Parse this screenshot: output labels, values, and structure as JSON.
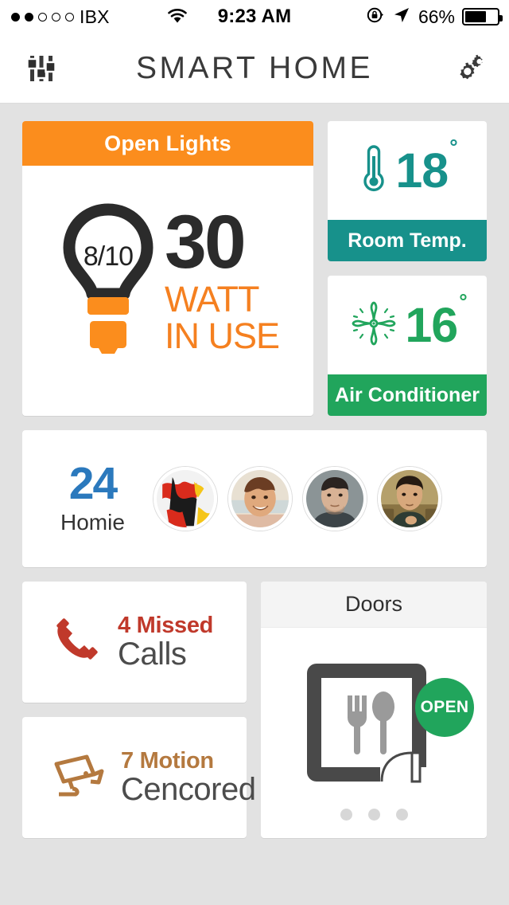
{
  "status_bar": {
    "carrier": "IBX",
    "signal_dots_filled": 2,
    "signal_dots_total": 5,
    "wifi_icon": "wifi-icon",
    "time": "9:23 AM",
    "lock_rotation_icon": "rotation-lock-icon",
    "location_icon": "location-arrow-icon",
    "battery_percent": "66%",
    "battery_level": 66
  },
  "navbar": {
    "left_icon": "sliders-icon",
    "title": "SMART HOME",
    "right_icon": "gears-icon"
  },
  "lights_card": {
    "header": "Open Lights",
    "header_color": "#fb8d1d",
    "bulb_fraction": "8/10",
    "watt_value": "30",
    "watt_label_line1": "WATT",
    "watt_label_line2": "IN USE",
    "watt_label_color": "#f58020",
    "bulb_icon": "lightbulb-icon"
  },
  "room_temp_card": {
    "icon": "thermometer-icon",
    "value": "18",
    "degree": "°",
    "label": "Room Temp.",
    "color": "#17918b"
  },
  "air_conditioner_card": {
    "icon": "fan-icon",
    "value": "16",
    "degree": "°",
    "label": "Air Conditioner",
    "color": "#21a55c"
  },
  "homie_card": {
    "count": "24",
    "label": "Homie",
    "count_color": "#2b79bd",
    "avatars": [
      {
        "name": "avatar-1",
        "description": "abstract red black white artwork"
      },
      {
        "name": "avatar-2",
        "description": "smiling man outdoors"
      },
      {
        "name": "avatar-3",
        "description": "man on gray background"
      },
      {
        "name": "avatar-4",
        "description": "man on sepia background"
      }
    ]
  },
  "missed_calls_card": {
    "icon": "phone-handset-icon",
    "line1": "4 Missed",
    "line2": "Calls",
    "line1_color": "#c0392b"
  },
  "motion_card": {
    "icon": "security-camera-icon",
    "line1": "7 Motion",
    "line2": "Cencored",
    "line1_color": "#b4793f"
  },
  "doors_card": {
    "header": "Doors",
    "illustration_icon": "kitchen-door-icon",
    "badge_label": "OPEN",
    "badge_color": "#21a55c",
    "pagination_dots": 3,
    "active_dot_index": 0
  }
}
